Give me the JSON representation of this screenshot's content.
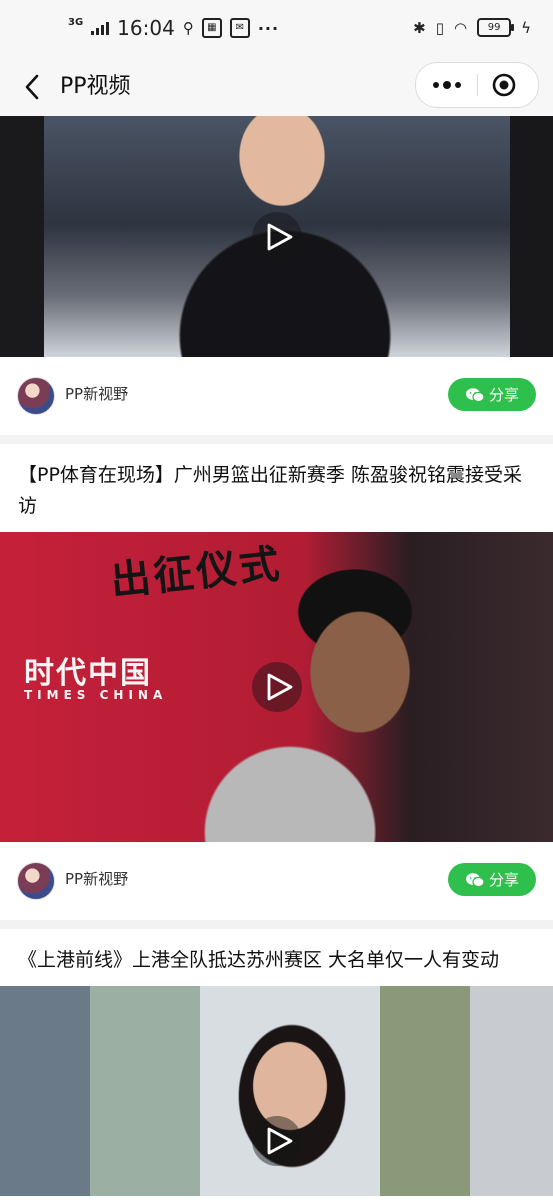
{
  "status_bar": {
    "network": "3G",
    "time": "16:04",
    "usb_icon": "usb-icon",
    "battery": "99"
  },
  "nav": {
    "title": "PP视频"
  },
  "posts": [
    {
      "title": "",
      "author": "PP新视野",
      "share_label": "分享"
    },
    {
      "title": "【PP体育在现场】广州男篮出征新赛季 陈盈骏祝铭震接受采访",
      "overlay_text_1": "出征仪式",
      "overlay_text_2": "时代中国",
      "overlay_text_3": "TIMES CHINA",
      "author": "PP新视野",
      "share_label": "分享"
    },
    {
      "title": "《上港前线》上港全队抵达苏州赛区 大名单仅一人有变动"
    }
  ],
  "colors": {
    "share_green": "#2fbf4c",
    "nav_bg": "#f7f7f7",
    "separator": "#f2f2f2"
  }
}
